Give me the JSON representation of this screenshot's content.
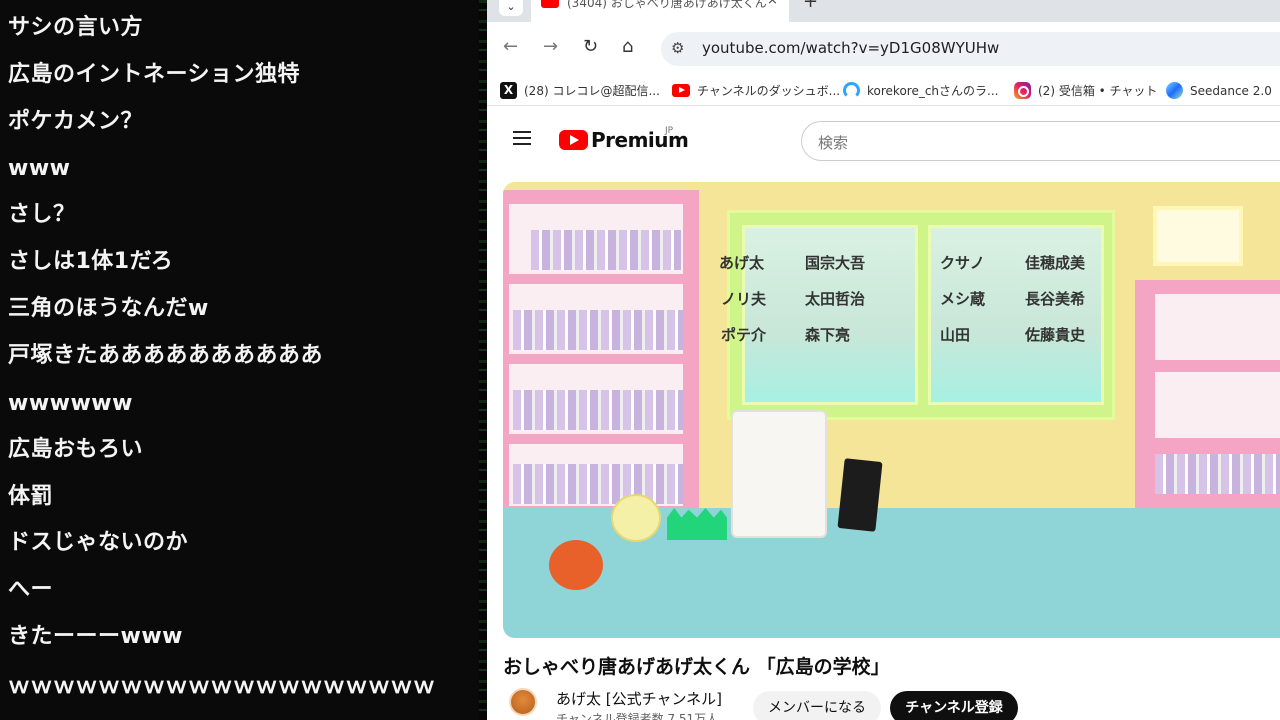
{
  "comments": [
    "サシの言い方",
    "広島のイントネーション独特",
    "ポケカメン？",
    "www",
    "さし？",
    "さしは1体1だろ",
    "三角のほうなんだw",
    "戸塚きたああああああああああ",
    "wwwwww",
    "広島おもろい",
    "体罰",
    "ドスじゃないのか",
    "へー",
    "きたーーーwww",
    "ｗｗｗｗｗｗｗｗｗｗｗｗｗｗｗｗｗｗｗ"
  ],
  "browser": {
    "tab_title": "(3404) おしゃべり唐あげあげ太くん",
    "tab_close": "×",
    "new_tab": "+",
    "url": "youtube.com/watch?v=yD1G08WYUHw",
    "bookmarks": [
      {
        "label": "(28) コレコレ@超配信...",
        "icon": "x-icon"
      },
      {
        "label": "チャンネルのダッシュボ...",
        "icon": "youtube-icon"
      },
      {
        "label": "korekore_chさんのラ...",
        "icon": "korekore-icon"
      },
      {
        "label": "(2) 受信箱 • チャット",
        "icon": "instagram-icon"
      },
      {
        "label": "Seedance 2.0",
        "icon": "seedance-icon"
      }
    ]
  },
  "youtube": {
    "brand": "Premium",
    "region": "JP",
    "search_placeholder": "検索",
    "video_credits_left": [
      "あげ太",
      "国宗大吾",
      "ノリ夫",
      "太田哲治",
      "ポテ介",
      "森下亮"
    ],
    "video_credits_right": [
      "クサノ",
      "佳穂成美",
      "メシ蔵",
      "長谷美希",
      "山田",
      "佐藤貴史"
    ],
    "video_title": "おしゃべり唐あげあげ太くん 「広島の学校」",
    "channel_name": "あげ太 [公式チャンネル]",
    "channel_subs": "チャンネル登録者数 7.51万人",
    "member_button": "メンバーになる",
    "subscribe_button": "チャンネル登録"
  }
}
